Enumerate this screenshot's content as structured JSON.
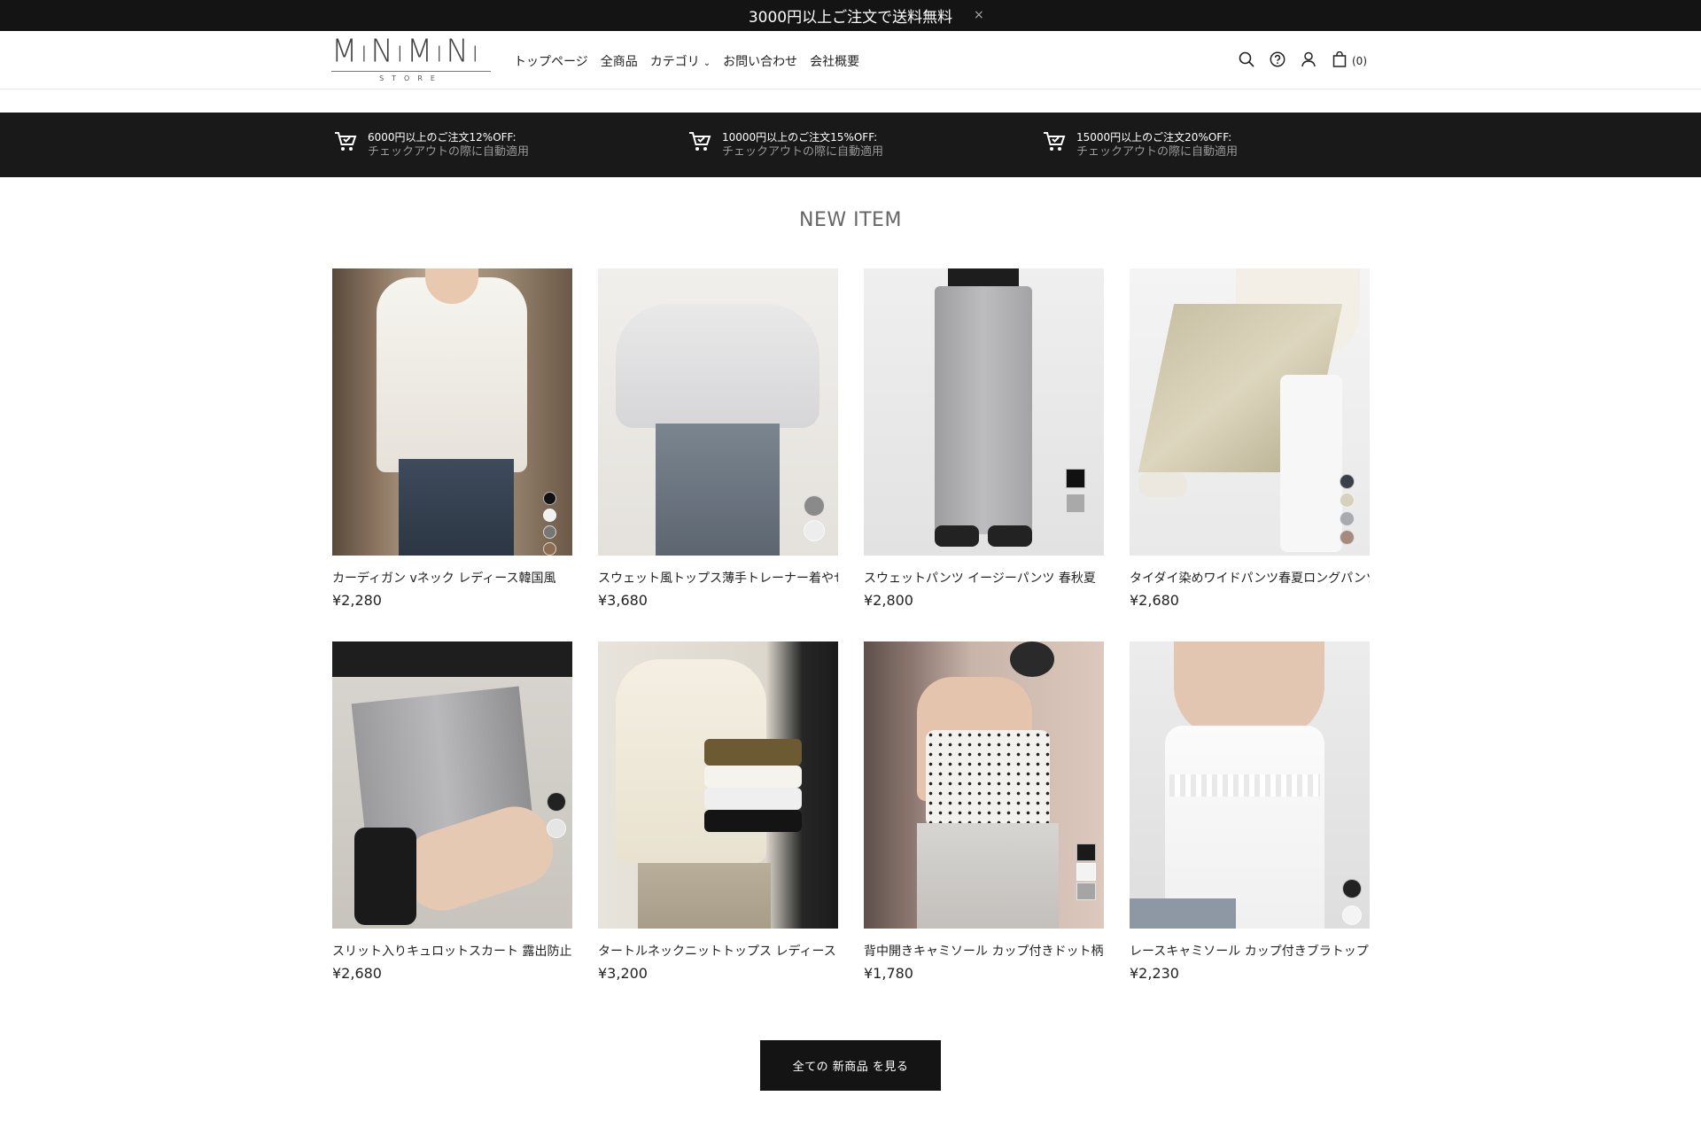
{
  "announcement": {
    "text": "3000円以上ご注文で送料無料",
    "close": "×"
  },
  "header": {
    "logo_text": "MiNiMiNi",
    "logo_sub": "STORE",
    "nav": [
      "トップページ",
      "全商品",
      "カテゴリ",
      "お問い合わせ",
      "会社概要"
    ],
    "cart_count": "(0)"
  },
  "promos": [
    {
      "title": "6000円以上のご注文12%OFF:",
      "sub": "チェックアウトの際に自動適用"
    },
    {
      "title": "10000円以上のご注文15%OFF:",
      "sub": "チェックアウトの際に自動適用"
    },
    {
      "title": "15000円以上のご注文20%OFF:",
      "sub": "チェックアウトの際に自動適用"
    }
  ],
  "section_title": "NEW ITEM",
  "products": [
    {
      "name": "カーディガン vネック レディース韓国風",
      "price": "¥2,280"
    },
    {
      "name": "スウェット風トップス薄手トレーナー着やせ",
      "price": "¥3,680"
    },
    {
      "name": "スウェットパンツ イージーパンツ 春秋夏",
      "price": "¥2,800"
    },
    {
      "name": "タイダイ染めワイドパンツ春夏ロングパンツ",
      "price": "¥2,680"
    },
    {
      "name": "スリット入りキュロットスカート 露出防止",
      "price": "¥2,680"
    },
    {
      "name": "タートルネックニットトップス レディース",
      "price": "¥3,200"
    },
    {
      "name": "背中開きキャミソール カップ付きドット柄",
      "price": "¥1,780"
    },
    {
      "name": "レースキャミソール カップ付きブラトップ",
      "price": "¥2,230"
    }
  ],
  "cta_label": "全ての 新商品 を見る",
  "colors": {
    "dark": "#141414",
    "promo_bg": "#191919",
    "muted": "#9a9a9a"
  }
}
